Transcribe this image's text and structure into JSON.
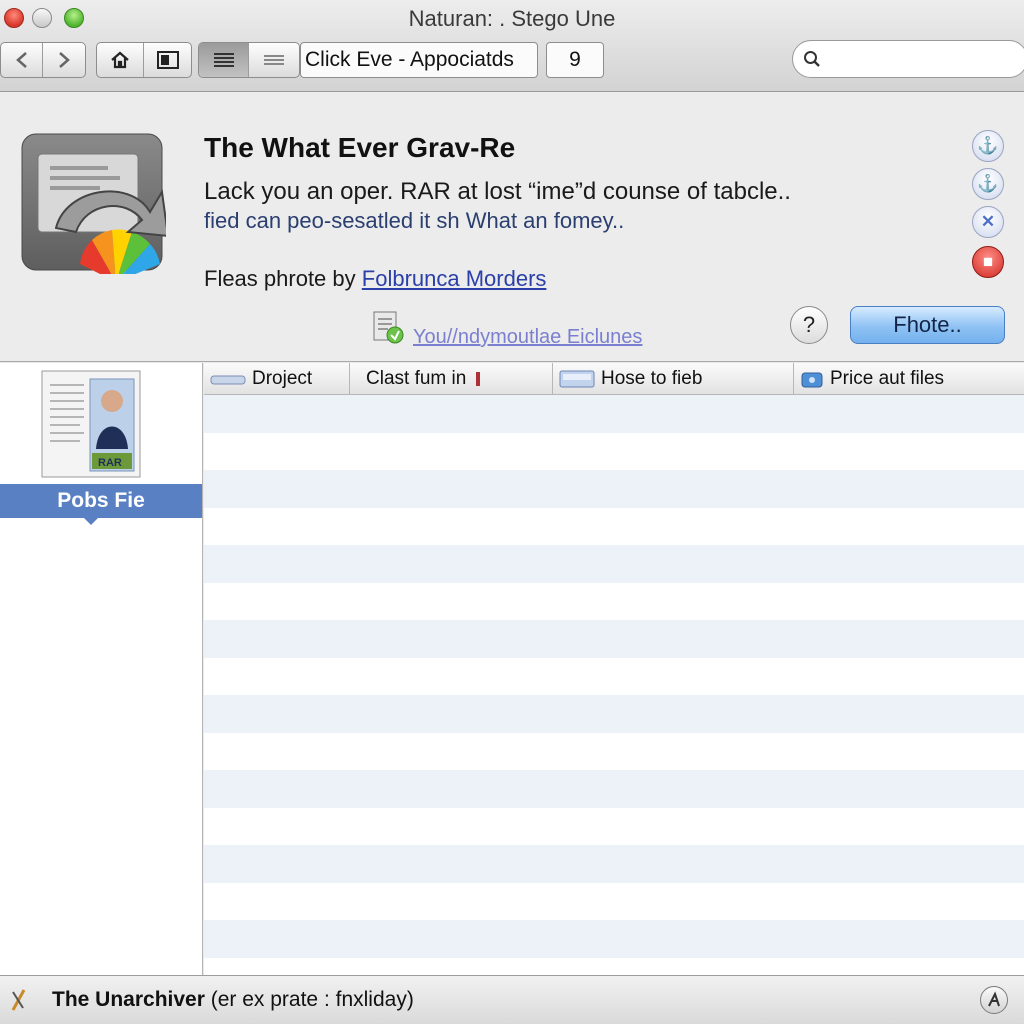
{
  "window": {
    "title": "Naturan: . Stego Une"
  },
  "toolbar": {
    "back_label": "◀",
    "forward_label": "▶",
    "location_text": "Click Eve - Appociatds",
    "count_label": "9",
    "search_placeholder": ""
  },
  "info": {
    "title": "The What Ever Grav-Re",
    "line1": "Lack you an oper. RAR at lost “ime”d counse of tabcle..",
    "line2": "fied can peo-sesatled it sh What an fomey..",
    "credit_prefix": "Fleas phrote by",
    "credit_link": "Folbrunca Morders",
    "doc_link": "You//ndymoutlae Eiclunes",
    "help_label": "?",
    "primary_button": "Fhote..",
    "side_icons": [
      {
        "glyph": "⚓",
        "icon": "info-icon"
      },
      {
        "glyph": "⚓",
        "icon": "info-icon"
      },
      {
        "glyph": "✕",
        "icon": "close-icon"
      },
      {
        "glyph": "■",
        "icon": "stop-icon"
      }
    ]
  },
  "sidebar": {
    "thumb_badge": "RAR",
    "items": [
      {
        "label": "Pobs Fie"
      }
    ]
  },
  "list": {
    "columns": [
      {
        "label": "Droject"
      },
      {
        "label": "Clast fum in"
      },
      {
        "label": "Hose to fieb"
      },
      {
        "label": "Price aut files"
      }
    ],
    "row_count": 15
  },
  "status": {
    "icon_glyph": "9",
    "app_name": "The Unarchiver",
    "detail": "(er ex prate : fnxliday)"
  },
  "colors": {
    "selection": "#5a80c4",
    "primary_button": "#8fc2f3",
    "row_stripe": "#edf1f8"
  }
}
